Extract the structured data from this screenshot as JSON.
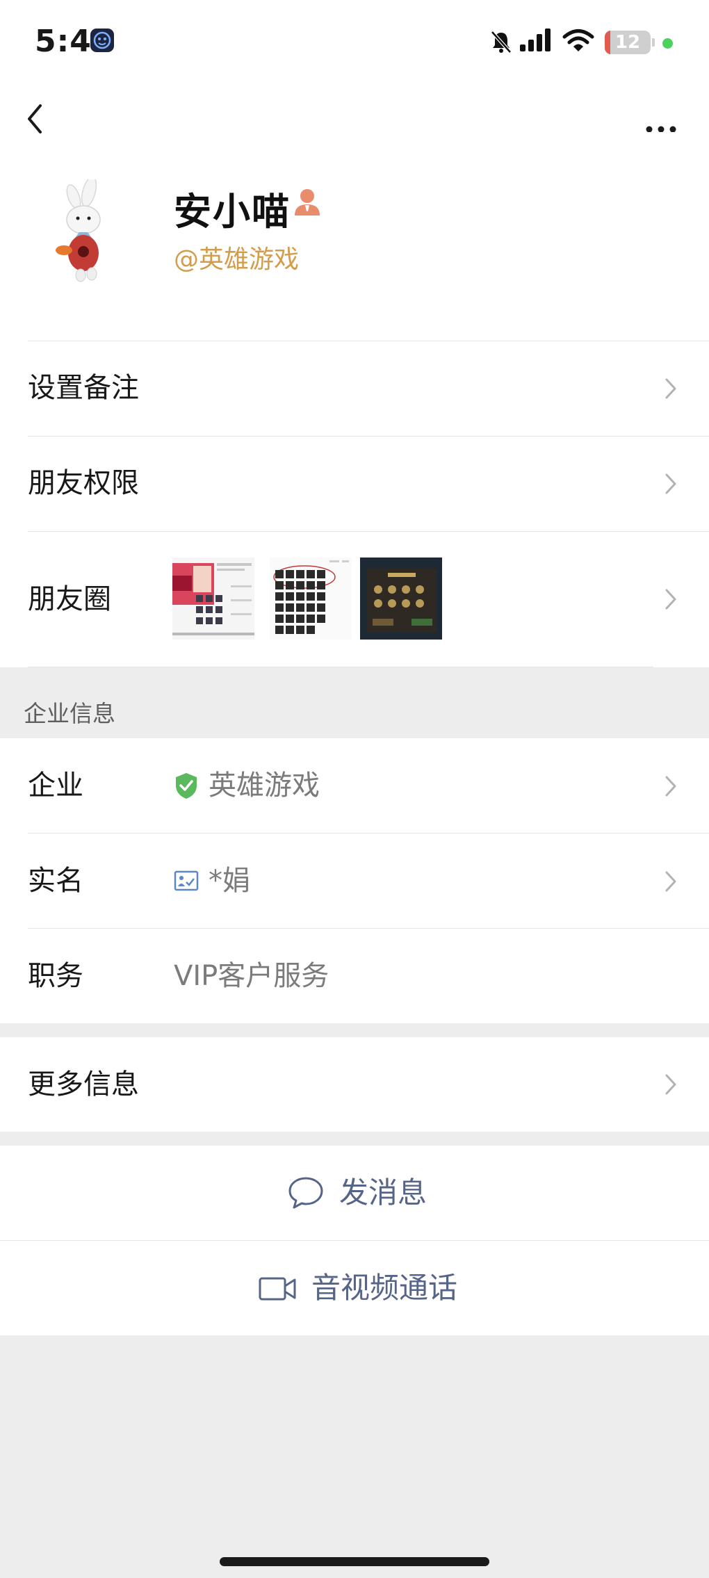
{
  "status_bar": {
    "time": "5:41",
    "battery": "12",
    "battery_level": 0.12
  },
  "profile": {
    "name": "安小喵",
    "handle": "@英雄游戏"
  },
  "rows": {
    "set_remark": "设置备注",
    "friend_permissions": "朋友权限",
    "moments": "朋友圈"
  },
  "enterprise_section": {
    "title": "企业信息",
    "enterprise_label": "企业",
    "enterprise_value": "英雄游戏",
    "realname_label": "实名",
    "realname_value": "*娟",
    "position_label": "职务",
    "position_value": "VIP客户服务"
  },
  "more_info": "更多信息",
  "actions": {
    "send_message": "发消息",
    "av_call": "音视频通话"
  },
  "colors": {
    "accent_link": "#566587",
    "handle": "#d39d4b",
    "verified_green": "#5cb85c"
  }
}
